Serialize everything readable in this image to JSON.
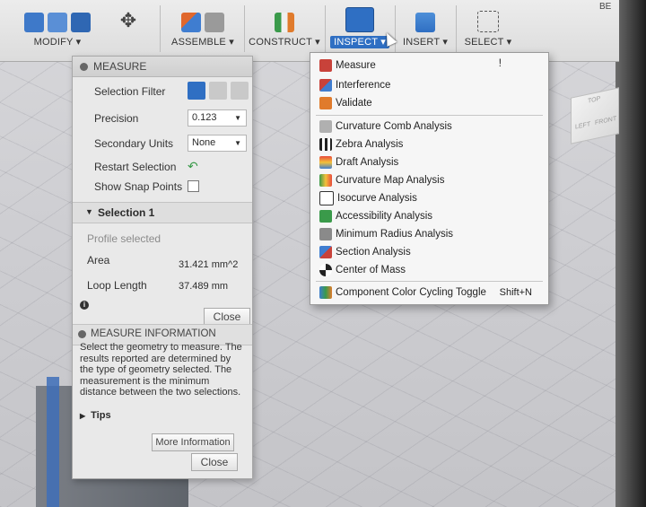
{
  "toolbar": {
    "groups": [
      {
        "label": "MODIFY ▾"
      },
      {
        "label": "ASSEMBLE ▾"
      },
      {
        "label": "CONSTRUCT ▾"
      },
      {
        "label": "INSPECT ▾"
      },
      {
        "label": "INSERT ▾"
      },
      {
        "label": "SELECT ▾"
      }
    ],
    "corner_text": "BE"
  },
  "measure_panel": {
    "title": "MEASURE",
    "selection_filter_label": "Selection Filter",
    "precision_label": "Precision",
    "precision_value": "0.123",
    "secondary_units_label": "Secondary Units",
    "secondary_units_value": "None",
    "restart_selection_label": "Restart Selection",
    "show_snap_points_label": "Show Snap Points",
    "selection_section_title": "Selection 1",
    "profile_selected_text": "Profile selected",
    "area_label": "Area",
    "area_value": "31.421 mm^2",
    "loop_length_label": "Loop Length",
    "loop_length_value": "37.489 mm",
    "close_label": "Close",
    "info_title": "MEASURE INFORMATION",
    "info_text": "Select the geometry to measure. The results reported are determined by the type of geometry selected. The measurement is the minimum distance between the two selections.",
    "tips_label": "Tips",
    "more_info_label": "More Information",
    "close_label_2": "Close"
  },
  "inspect_menu": {
    "items_group1": [
      {
        "label": "Measure",
        "icon": "ruler-icon"
      },
      {
        "label": "Interference",
        "icon": "interference-icon"
      },
      {
        "label": "Validate",
        "icon": "validate-icon"
      }
    ],
    "items_group2": [
      {
        "label": "Curvature Comb Analysis",
        "icon": "curvature-comb-icon"
      },
      {
        "label": "Zebra Analysis",
        "icon": "zebra-icon"
      },
      {
        "label": "Draft Analysis",
        "icon": "draft-icon"
      },
      {
        "label": "Curvature Map Analysis",
        "icon": "curvature-map-icon"
      },
      {
        "label": "Isocurve Analysis",
        "icon": "isocurve-icon"
      },
      {
        "label": "Accessibility Analysis",
        "icon": "accessibility-icon"
      },
      {
        "label": "Minimum Radius Analysis",
        "icon": "minimum-radius-icon"
      },
      {
        "label": "Section Analysis",
        "icon": "section-icon"
      },
      {
        "label": "Center of Mass",
        "icon": "center-of-mass-icon"
      }
    ],
    "items_group3": [
      {
        "label": "Component Color Cycling Toggle",
        "shortcut": "Shift+N",
        "icon": "color-cycling-icon"
      }
    ]
  },
  "view_cube": {
    "top_label": "TOP",
    "front_label": "FRONT",
    "left_label": "LEFT"
  },
  "colors": {
    "accent": "#2f6fc3",
    "panel_bg": "#e9e9e9",
    "menu_bg": "#f6f6f6"
  }
}
